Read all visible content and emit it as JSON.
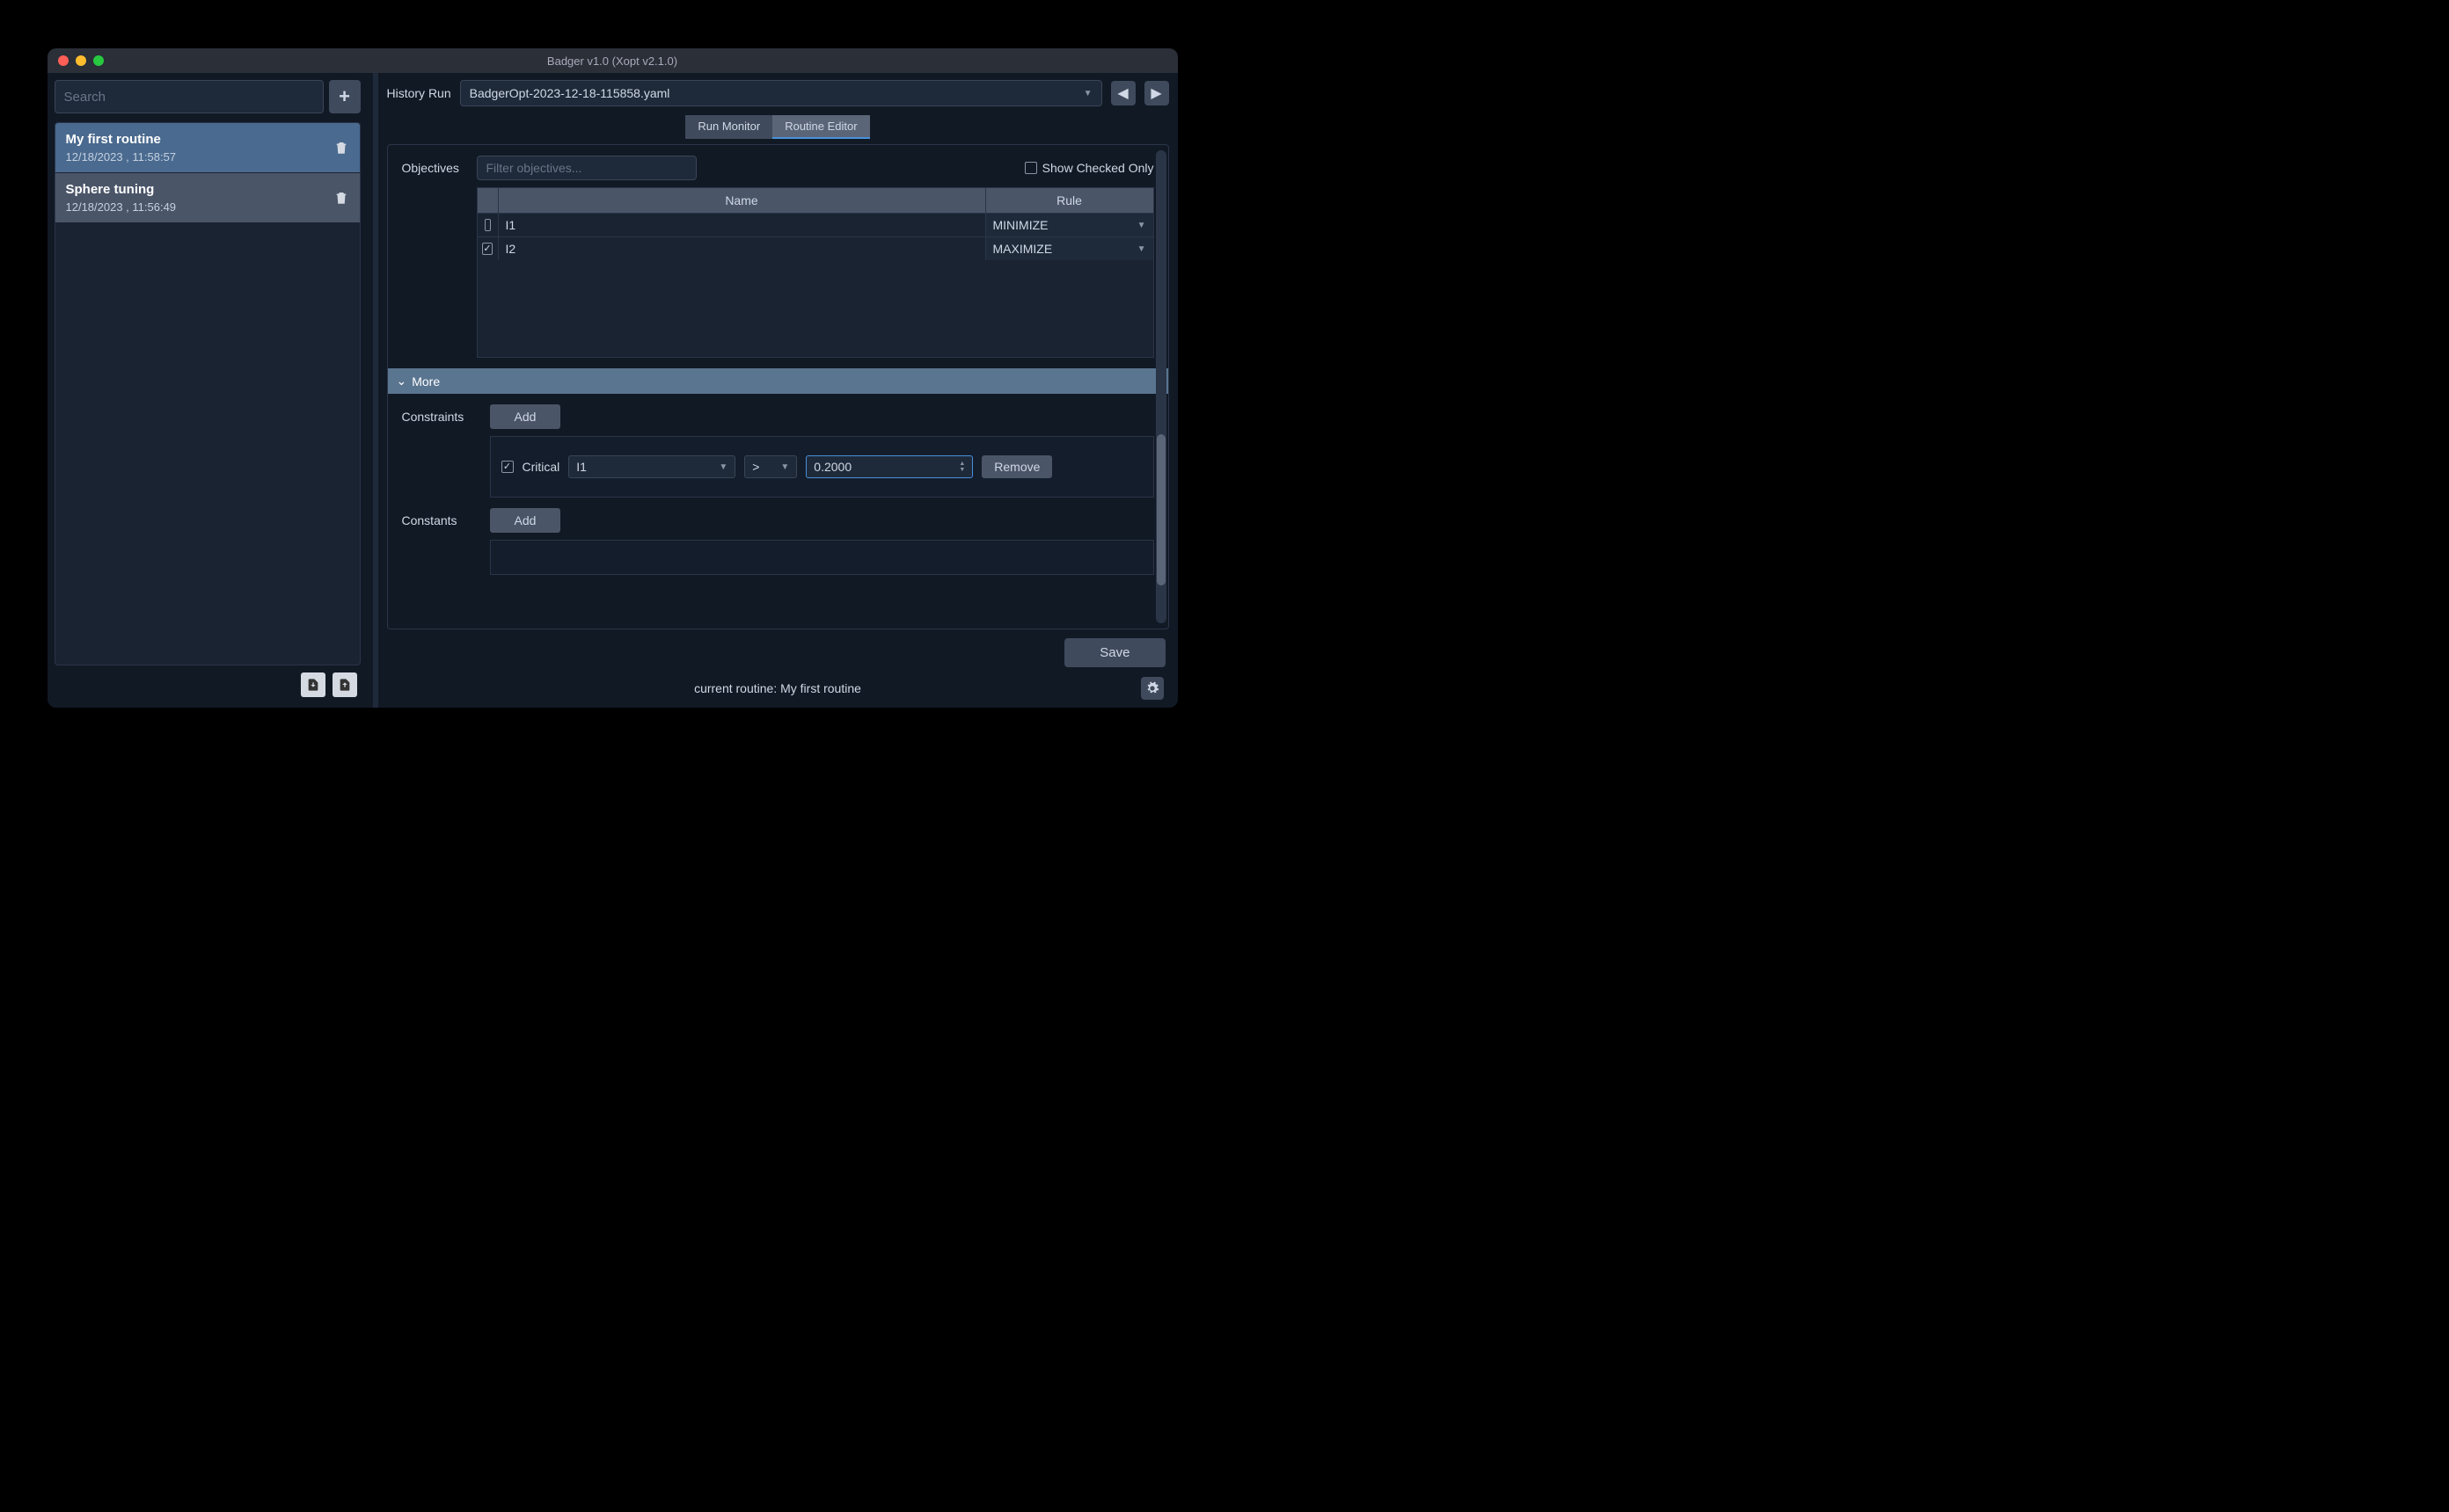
{
  "window": {
    "title": "Badger v1.0 (Xopt v2.1.0)"
  },
  "sidebar": {
    "search_placeholder": "Search",
    "routines": [
      {
        "name": "My first routine",
        "date": "12/18/2023 , 11:58:57",
        "selected": true
      },
      {
        "name": "Sphere tuning",
        "date": "12/18/2023 , 11:56:49",
        "selected": false
      }
    ]
  },
  "header": {
    "history_label": "History Run",
    "history_value": "BadgerOpt-2023-12-18-115858.yaml"
  },
  "tabs": {
    "run_monitor": "Run Monitor",
    "routine_editor": "Routine Editor"
  },
  "objectives": {
    "label": "Objectives",
    "filter_placeholder": "Filter objectives...",
    "show_checked_label": "Show Checked Only",
    "columns": {
      "name": "Name",
      "rule": "Rule"
    },
    "rows": [
      {
        "checked": false,
        "name": "I1",
        "rule": "MINIMIZE"
      },
      {
        "checked": true,
        "name": "I2",
        "rule": "MAXIMIZE"
      }
    ]
  },
  "more": {
    "label": "More"
  },
  "constraints": {
    "label": "Constraints",
    "add_label": "Add",
    "rows": [
      {
        "critical": true,
        "critical_label": "Critical",
        "var": "I1",
        "op": ">",
        "value": "0.2000",
        "remove_label": "Remove"
      }
    ]
  },
  "constants": {
    "label": "Constants",
    "add_label": "Add"
  },
  "footer": {
    "save_label": "Save"
  },
  "status": {
    "text": "current routine: My first routine"
  }
}
